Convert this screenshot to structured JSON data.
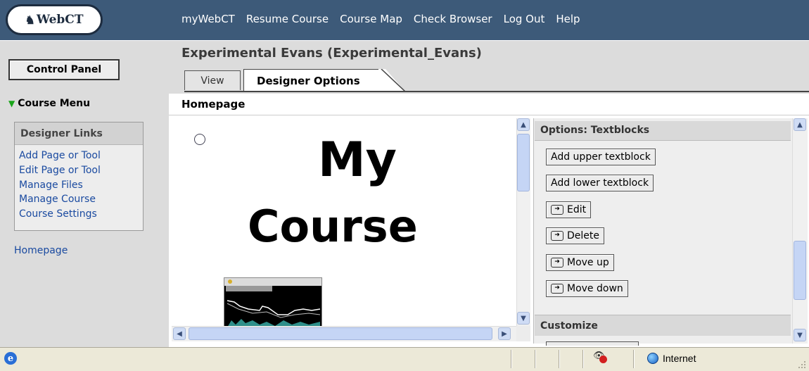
{
  "app": {
    "logo_text": "WebCT"
  },
  "top_nav": [
    "myWebCT",
    "Resume Course",
    "Course Map",
    "Check Browser",
    "Log Out",
    "Help"
  ],
  "header": {
    "control_panel_label": "Control Panel",
    "course_title": "Experimental Evans  (Experimental_Evans)",
    "tabs": [
      {
        "label": "View",
        "active": false
      },
      {
        "label": "Designer Options",
        "active": true
      }
    ]
  },
  "course_menu": {
    "label": "Course Menu"
  },
  "page": {
    "title": "Homepage"
  },
  "designer_links": {
    "title": "Designer Links",
    "items": [
      "Add Page or Tool",
      "Edit Page or Tool",
      "Manage Files",
      "Manage Course",
      "Course Settings"
    ]
  },
  "left_links": [
    "Homepage"
  ],
  "content": {
    "heading_line1": "My",
    "heading_line2": "Course"
  },
  "options_panel": {
    "textblocks_header": "Options: Textblocks",
    "buttons": [
      "Add upper textblock",
      "Add lower textblock",
      "Edit",
      "Delete",
      "Move up",
      "Move down"
    ],
    "customize_header": "Customize"
  },
  "status_bar": {
    "zone": "Internet"
  },
  "colors": {
    "top_bar": "#3d5a79",
    "panel_gray": "#dcdcdc",
    "link": "#1a4aa0"
  }
}
